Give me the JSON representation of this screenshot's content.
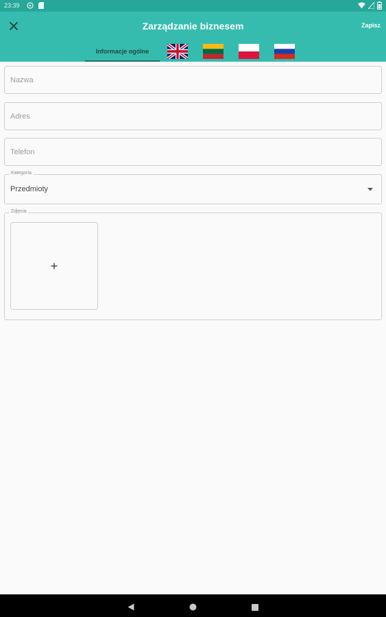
{
  "status_bar": {
    "time": "23:39"
  },
  "app_bar": {
    "title": "Zarządzanie biznesem",
    "save_label": "Zapisz"
  },
  "tabs": [
    {
      "label": "Informacje ogólne"
    },
    {
      "flag": "uk-flag-icon"
    },
    {
      "flag": "lithuania-flag-icon"
    },
    {
      "flag": "poland-flag-icon"
    },
    {
      "flag": "russia-flag-icon"
    }
  ],
  "form": {
    "name_placeholder": "Nazwa",
    "address_placeholder": "Adres",
    "phone_placeholder": "Telefon",
    "category_label": "Kategoria",
    "category_value": "Przedmioty",
    "photos_label": "Zdjęcia"
  },
  "colors": {
    "primary": "#35bcae",
    "status_bar": "#27a69a",
    "tab_indicator": "#1f6f66"
  }
}
